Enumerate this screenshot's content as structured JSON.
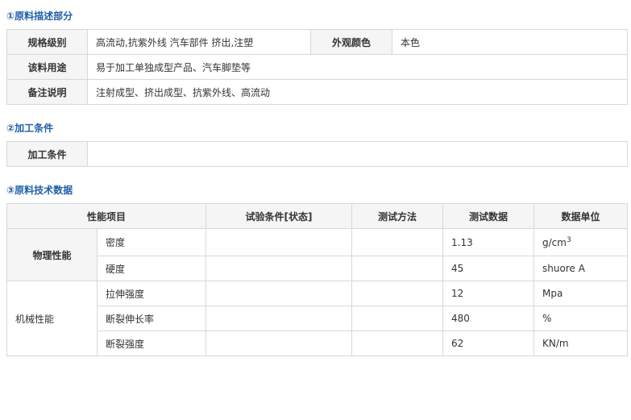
{
  "section1": {
    "title": "①原料描述部分",
    "spec_label": "规格级别",
    "spec_value": "高流动,抗紫外线 汽车部件 挤出,注塑",
    "color_label": "外观颜色",
    "color_value": "本色",
    "use_label": "该料用途",
    "use_value": "易于加工单独成型产品、汽车脚垫等",
    "note_label": "备注说明",
    "note_value": "注射成型、挤出成型、抗紫外线、高流动"
  },
  "section2": {
    "title": "②加工条件",
    "label": "加工条件",
    "value": ""
  },
  "section3": {
    "title": "③原料技术数据",
    "headers": {
      "property": "性能项目",
      "condition": "试验条件[状态]",
      "method": "测试方法",
      "data": "测试数据",
      "unit": "数据单位"
    },
    "groups": {
      "physical": "物理性能",
      "mechanical": "机械性能"
    },
    "rows": [
      {
        "item": "密度",
        "condition": "",
        "method": "",
        "data": "1.13",
        "unit": "g/cm",
        "unit_sup": "3"
      },
      {
        "item": "硬度",
        "condition": "",
        "method": "",
        "data": "45",
        "unit": "shuore A"
      },
      {
        "item": "拉伸强度",
        "condition": "",
        "method": "",
        "data": "12",
        "unit": "Mpa"
      },
      {
        "item": "断裂伸长率",
        "condition": "",
        "method": "",
        "data": "480",
        "unit": "%"
      },
      {
        "item": "断裂强度",
        "condition": "",
        "method": "",
        "data": "62",
        "unit": "KN/m"
      }
    ]
  }
}
